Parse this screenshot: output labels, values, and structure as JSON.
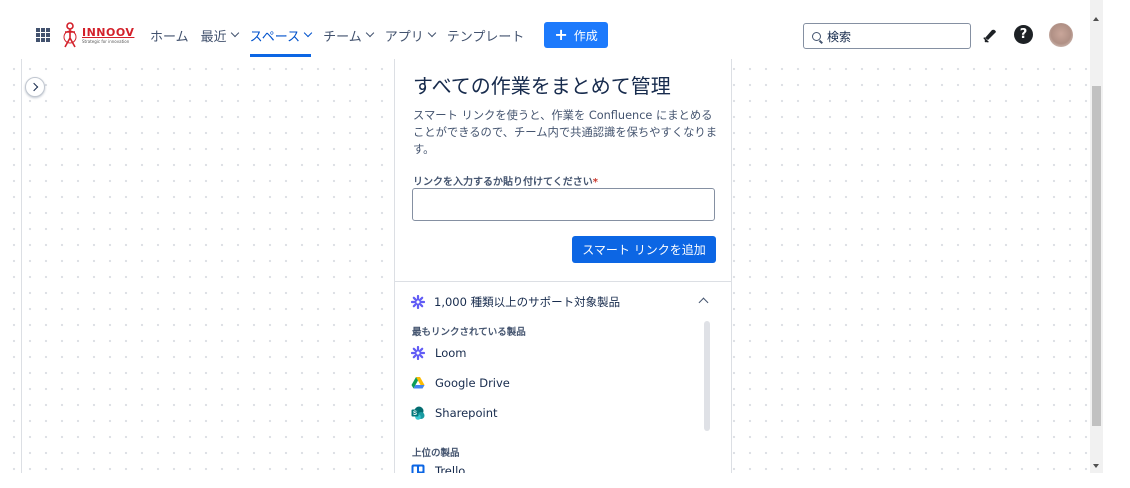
{
  "nav": {
    "logo_name": "INNOOV",
    "logo_tag": "Strategic for innovation",
    "items": [
      {
        "label": "ホーム",
        "dropdown": false
      },
      {
        "label": "最近",
        "dropdown": true
      },
      {
        "label": "スペース",
        "dropdown": true,
        "active": true
      },
      {
        "label": "チーム",
        "dropdown": true
      },
      {
        "label": "アプリ",
        "dropdown": true
      },
      {
        "label": "テンプレート",
        "dropdown": false
      }
    ],
    "create_label": "作成",
    "search_placeholder": "検索",
    "help_glyph": "?"
  },
  "panel": {
    "title": "すべての作業をまとめて管理",
    "description": "スマート リンクを使うと、作業を Confluence にまとめることができるので、チーム内で共通認識を保ちやすくなります。",
    "field_label": "リンクを入力するか貼り付けてください",
    "required_mark": "*",
    "input_value": "",
    "add_button": "スマート リンクを追加",
    "supported_heading": "1,000 種類以上のサポート対象製品",
    "most_linked_label": "最もリンクされている製品",
    "products": [
      {
        "name": "Loom",
        "icon": "loom-icon"
      },
      {
        "name": "Google Drive",
        "icon": "google-drive-icon"
      },
      {
        "name": "Sharepoint",
        "icon": "sharepoint-icon"
      }
    ],
    "top_label": "上位の製品",
    "partial_product": "Trello"
  },
  "colors": {
    "accent": "#0c66e4",
    "create": "#1d7afc",
    "loom": "#625df5",
    "required": "#c9372c"
  }
}
